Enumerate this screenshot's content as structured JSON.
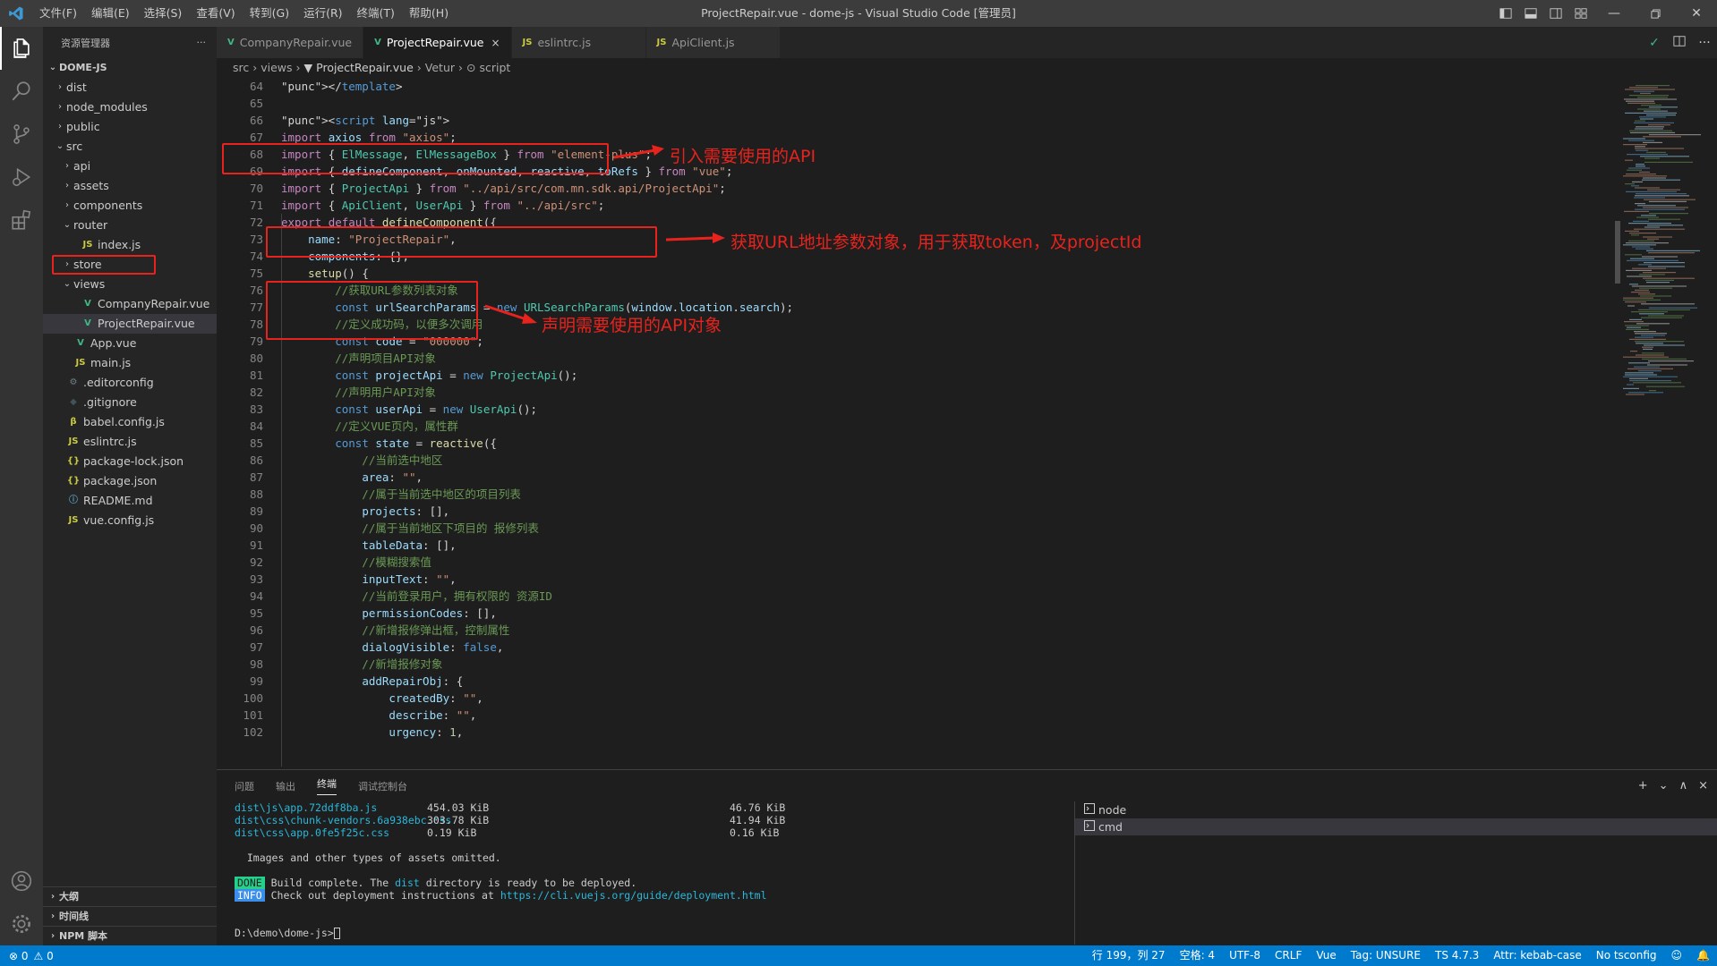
{
  "window": {
    "title": "ProjectRepair.vue - dome-js - Visual Studio Code [管理员]",
    "logo": "VS"
  },
  "menu": [
    "文件(F)",
    "编辑(E)",
    "选择(S)",
    "查看(V)",
    "转到(G)",
    "运行(R)",
    "终端(T)",
    "帮助(H)"
  ],
  "sidebar": {
    "title": "资源管理器",
    "more": "···",
    "root": "DOME-JS",
    "items": [
      {
        "label": "dist",
        "depth": 1,
        "chev": "›",
        "icon": ""
      },
      {
        "label": "node_modules",
        "depth": 1,
        "chev": "›",
        "icon": ""
      },
      {
        "label": "public",
        "depth": 1,
        "chev": "›",
        "icon": ""
      },
      {
        "label": "src",
        "depth": 1,
        "chev": "⌄",
        "icon": ""
      },
      {
        "label": "api",
        "depth": 2,
        "chev": "›",
        "icon": ""
      },
      {
        "label": "assets",
        "depth": 2,
        "chev": "›",
        "icon": ""
      },
      {
        "label": "components",
        "depth": 2,
        "chev": "›",
        "icon": ""
      },
      {
        "label": "router",
        "depth": 2,
        "chev": "⌄",
        "icon": ""
      },
      {
        "label": "index.js",
        "depth": 3,
        "chev": "",
        "icon": "JS"
      },
      {
        "label": "store",
        "depth": 2,
        "chev": "›",
        "icon": ""
      },
      {
        "label": "views",
        "depth": 2,
        "chev": "⌄",
        "icon": ""
      },
      {
        "label": "CompanyRepair.vue",
        "depth": 3,
        "chev": "",
        "icon": "V"
      },
      {
        "label": "ProjectRepair.vue",
        "depth": 3,
        "chev": "",
        "icon": "V"
      },
      {
        "label": "App.vue",
        "depth": 2,
        "chev": "",
        "icon": "V"
      },
      {
        "label": "main.js",
        "depth": 2,
        "chev": "",
        "icon": "JS"
      },
      {
        "label": ".editorconfig",
        "depth": 1,
        "chev": "",
        "icon": "⚙"
      },
      {
        "label": ".gitignore",
        "depth": 1,
        "chev": "",
        "icon": "◆"
      },
      {
        "label": "babel.config.js",
        "depth": 1,
        "chev": "",
        "icon": "β"
      },
      {
        "label": "eslintrc.js",
        "depth": 1,
        "chev": "",
        "icon": "JS"
      },
      {
        "label": "package-lock.json",
        "depth": 1,
        "chev": "",
        "icon": "{}"
      },
      {
        "label": "package.json",
        "depth": 1,
        "chev": "",
        "icon": "{}"
      },
      {
        "label": "README.md",
        "depth": 1,
        "chev": "",
        "icon": "ⓘ"
      },
      {
        "label": "vue.config.js",
        "depth": 1,
        "chev": "",
        "icon": "JS"
      }
    ],
    "bottom": [
      "大纲",
      "时间线",
      "NPM 脚本"
    ]
  },
  "tabs": [
    {
      "label": "CompanyRepair.vue",
      "icon": "V",
      "active": false
    },
    {
      "label": "ProjectRepair.vue",
      "icon": "V",
      "active": true,
      "close": "×"
    },
    {
      "label": "eslintrc.js",
      "icon": "JS",
      "active": false
    },
    {
      "label": "ApiClient.js",
      "icon": "JS",
      "active": false
    }
  ],
  "breadcrumb": [
    "src",
    "›",
    "views",
    "›",
    "▼ ProjectRepair.vue",
    "›",
    "Vetur",
    "›",
    "⊙ script"
  ],
  "code": [
    {
      "n": "64",
      "t": "</template>"
    },
    {
      "n": "65",
      "t": ""
    },
    {
      "n": "66",
      "t": "<script lang=\"js\">"
    },
    {
      "n": "67",
      "t": "import axios from \"axios\";"
    },
    {
      "n": "68",
      "t": "import { ElMessage, ElMessageBox } from \"element-plus\";"
    },
    {
      "n": "69",
      "t": "import { defineComponent, onMounted, reactive, toRefs } from \"vue\";"
    },
    {
      "n": "70",
      "t": "import { ProjectApi } from \"../api/src/com.mn.sdk.api/ProjectApi\";"
    },
    {
      "n": "71",
      "t": "import { ApiClient, UserApi } from \"../api/src\";"
    },
    {
      "n": "72",
      "t": "export default defineComponent({"
    },
    {
      "n": "73",
      "t": "    name: \"ProjectRepair\","
    },
    {
      "n": "74",
      "t": "    components: {},"
    },
    {
      "n": "75",
      "t": "    setup() {"
    },
    {
      "n": "76",
      "t": "        //获取URL参数列表对象"
    },
    {
      "n": "77",
      "t": "        const urlSearchParams = new URLSearchParams(window.location.search);"
    },
    {
      "n": "78",
      "t": "        //定义成功码，以便多次调用"
    },
    {
      "n": "79",
      "t": "        const code = \"000000\";"
    },
    {
      "n": "80",
      "t": "        //声明项目API对象"
    },
    {
      "n": "81",
      "t": "        const projectApi = new ProjectApi();"
    },
    {
      "n": "82",
      "t": "        //声明用户API对象"
    },
    {
      "n": "83",
      "t": "        const userApi = new UserApi();"
    },
    {
      "n": "84",
      "t": "        //定义VUE页内，属性群"
    },
    {
      "n": "85",
      "t": "        const state = reactive({"
    },
    {
      "n": "86",
      "t": "            //当前选中地区"
    },
    {
      "n": "87",
      "t": "            area: \"\","
    },
    {
      "n": "88",
      "t": "            //属于当前选中地区的项目列表"
    },
    {
      "n": "89",
      "t": "            projects: [],"
    },
    {
      "n": "90",
      "t": "            //属于当前地区下项目的 报修列表"
    },
    {
      "n": "91",
      "t": "            tableData: [],"
    },
    {
      "n": "92",
      "t": "            //模糊搜索值"
    },
    {
      "n": "93",
      "t": "            inputText: \"\","
    },
    {
      "n": "94",
      "t": "            //当前登录用户，拥有权限的 资源ID"
    },
    {
      "n": "95",
      "t": "            permissionCodes: [],"
    },
    {
      "n": "96",
      "t": "            //新增报修弹出框，控制属性"
    },
    {
      "n": "97",
      "t": "            dialogVisible: false,"
    },
    {
      "n": "98",
      "t": "            //新增报修对象"
    },
    {
      "n": "99",
      "t": "            addRepairObj: {"
    },
    {
      "n": "100",
      "t": "                createdBy: \"\","
    },
    {
      "n": "101",
      "t": "                describe: \"\","
    },
    {
      "n": "102",
      "t": "                urgency: 1,"
    }
  ],
  "annotations": [
    {
      "text": "引入需要使用的API"
    },
    {
      "text": "获取URL地址参数对象，用于获取token，及projectId"
    },
    {
      "text": "声明需要使用的API对象"
    }
  ],
  "panel": {
    "tabs": [
      "问题",
      "输出",
      "终端",
      "调试控制台"
    ],
    "active_tab": "终端",
    "actions": [
      "+",
      "⌄",
      "∧",
      "×"
    ],
    "terminal": {
      "assets": [
        {
          "file": "dist\\js\\app.72ddf8ba.js",
          "size": "454.03 KiB",
          "gzip": "46.76 KiB"
        },
        {
          "file": "dist\\css\\chunk-vendors.6a938ebc.css",
          "size": "303.78 KiB",
          "gzip": "41.94 KiB"
        },
        {
          "file": "dist\\css\\app.0fe5f25c.css",
          "size": "0.19 KiB",
          "gzip": "0.16 KiB"
        }
      ],
      "omitted": "  Images and other types of assets omitted.",
      "done_badge": "DONE",
      "done_pre": " Build complete. The ",
      "done_dist": "dist",
      "done_post": " directory is ready to be deployed.",
      "info_badge": "INFO",
      "info_pre": " Check out deployment instructions at ",
      "info_url": "https://cli.vuejs.org/guide/deployment.html",
      "prompt": "D:\\demo\\dome-js>"
    },
    "terminals": [
      {
        "label": "node",
        "selected": false
      },
      {
        "label": "cmd",
        "selected": true
      }
    ]
  },
  "statusbar": {
    "left": {
      "errors": "⊗ 0",
      "warnings": "⚠ 0"
    },
    "right": [
      "行 199，列 27",
      "空格: 4",
      "UTF-8",
      "CRLF",
      "Vue",
      "Tag: UNSURE",
      "TS 4.7.3",
      "Attr: kebab-case",
      "No tsconfig"
    ]
  }
}
